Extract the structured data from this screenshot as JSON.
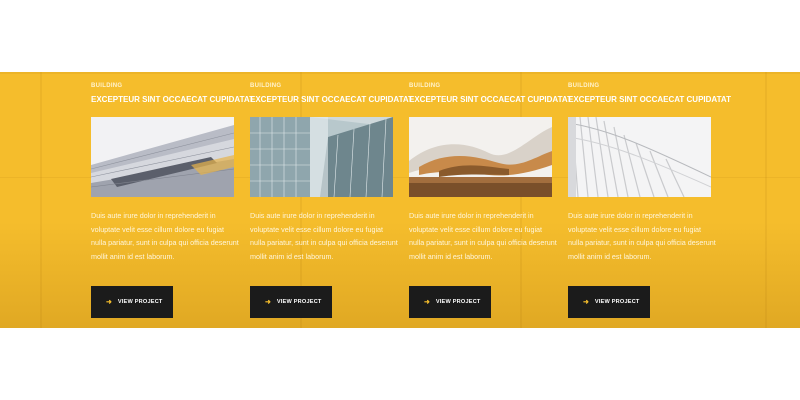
{
  "section": {
    "background_color": "#f5bd2c",
    "button_color": "#1b1b1b",
    "accent_color": "#f5bd2c"
  },
  "projects": [
    {
      "category": "BUILDING",
      "title": "EXCEPTEUR SINT OCCAECAT CUPIDATAT",
      "description": "Duis aute irure dolor in reprehenderit in voluptate velit esse cillum dolore eu fugiat nulla pariatur, sunt in culpa qui officia deserunt mollit anim id est laborum.",
      "button_label": "VIEW PROJECT",
      "button_icon": "arrow-right-icon",
      "image": "modern-building-facade"
    },
    {
      "category": "BUILDING",
      "title": "EXCEPTEUR SINT OCCAECAT CUPIDATAT",
      "description": "Duis aute irure dolor in reprehenderit in voluptate velit esse cillum dolore eu fugiat nulla pariatur, sunt in culpa qui officia deserunt mollit anim id est laborum.",
      "button_label": "VIEW PROJECT",
      "button_icon": "arrow-right-icon",
      "image": "glass-tower-facade"
    },
    {
      "category": "BUILDING",
      "title": "EXCEPTEUR SINT OCCAECAT CUPIDATAT",
      "description": "Duis aute irure dolor in reprehenderit in voluptate velit esse cillum dolore eu fugiat nulla pariatur, sunt in culpa qui officia deserunt mollit anim id est laborum.",
      "button_label": "VIEW PROJECT",
      "button_icon": "arrow-right-icon",
      "image": "wave-roof-building"
    },
    {
      "category": "BUILDING",
      "title": "EXCEPTEUR SINT OCCAECAT CUPIDATAT",
      "description": "Duis aute irure dolor in reprehenderit in voluptate velit esse cillum dolore eu fugiat nulla pariatur, sunt in culpa qui officia deserunt mollit anim id est laborum.",
      "button_label": "VIEW PROJECT",
      "button_icon": "arrow-right-icon",
      "image": "white-rib-structure"
    }
  ]
}
